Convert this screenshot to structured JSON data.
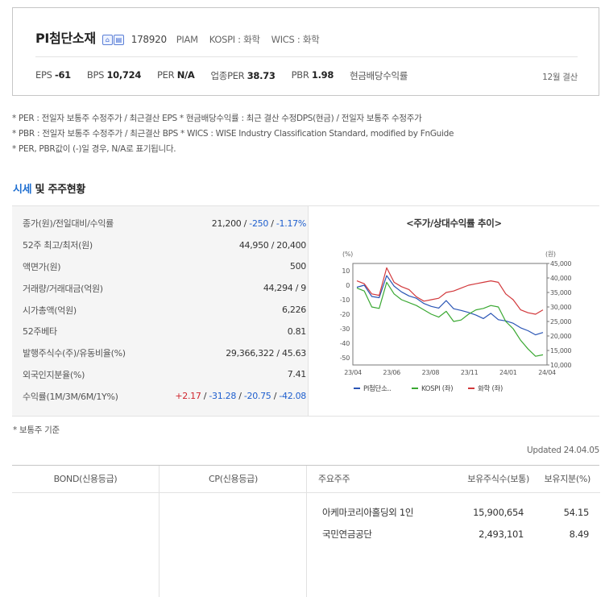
{
  "company": {
    "name": "PI첨단소재",
    "badge_icons": [
      "home-icon",
      "document-icon"
    ],
    "code": "178920",
    "english_code": "PIAM",
    "kospi": "KOSPI : 화학",
    "wics": "WICS : 화학"
  },
  "metrics": [
    {
      "label": "EPS",
      "value": "-61"
    },
    {
      "label": "BPS",
      "value": "10,724"
    },
    {
      "label": "PER",
      "value": "N/A"
    },
    {
      "label": "업종PER",
      "value": "38.73"
    },
    {
      "label": "PBR",
      "value": "1.98"
    },
    {
      "label": "현금배당수익률",
      "value": ""
    }
  ],
  "settlement": "12월 결산",
  "notes": [
    "* PER : 전일자 보통주 수정주가 / 최근결산 EPS * 현금배당수익률 : 최근 결산 수정DPS(현금) / 전일자 보통주 수정주가",
    "* PBR : 전일자 보통주 수정주가 / 최근결산 BPS * WICS : WISE Industry Classification Standard, modified by FnGuide",
    "* PER, PBR값이 (-)일 경우, N/A로 표기됩니다."
  ],
  "section": {
    "highlight": "시세",
    "rest": " 및 주주현황"
  },
  "market_stats": [
    {
      "label": "종가(원)/전일대비/수익률",
      "parts": [
        {
          "text": "21,200",
          "tone": "plain"
        },
        {
          "text": " / ",
          "tone": "plain"
        },
        {
          "text": "-250",
          "tone": "neg"
        },
        {
          "text": " / ",
          "tone": "plain"
        },
        {
          "text": "-1.17%",
          "tone": "neg"
        }
      ]
    },
    {
      "label": "52주 최고/최저(원)",
      "parts": [
        {
          "text": "44,950 / 20,400",
          "tone": "plain"
        }
      ]
    },
    {
      "label": "액면가(원)",
      "parts": [
        {
          "text": "500",
          "tone": "plain"
        }
      ]
    },
    {
      "label": "거래량/거래대금(억원)",
      "parts": [
        {
          "text": "44,294 / 9",
          "tone": "plain"
        }
      ]
    },
    {
      "label": "시가총액(억원)",
      "parts": [
        {
          "text": "6,226",
          "tone": "plain"
        }
      ]
    },
    {
      "label": "52주베타",
      "parts": [
        {
          "text": "0.81",
          "tone": "plain"
        }
      ]
    },
    {
      "label": "발행주식수(주)/유동비율(%)",
      "parts": [
        {
          "text": "29,366,322 / 45.63",
          "tone": "plain"
        }
      ]
    },
    {
      "label": "외국인지분율(%)",
      "parts": [
        {
          "text": "7.41",
          "tone": "plain"
        }
      ]
    },
    {
      "label": "수익률(1M/3M/6M/1Y%)",
      "parts": [
        {
          "text": "+2.17",
          "tone": "pos"
        },
        {
          "text": " / ",
          "tone": "plain"
        },
        {
          "text": "-31.28",
          "tone": "neg"
        },
        {
          "text": " / ",
          "tone": "plain"
        },
        {
          "text": "-20.75",
          "tone": "neg"
        },
        {
          "text": " / ",
          "tone": "plain"
        },
        {
          "text": "-42.08",
          "tone": "neg"
        }
      ]
    }
  ],
  "chart_title": "<주가/상대수익률 추이>",
  "chart_data": {
    "type": "line",
    "title": "<주가/상대수익률 추이>",
    "x_ticks": [
      "23/04",
      "23/06",
      "23/08",
      "23/11",
      "24/01",
      "24/04"
    ],
    "left_axis": {
      "unit": "(%)",
      "range": [
        -55,
        15
      ],
      "ticks": [
        10,
        0,
        -10,
        -20,
        -30,
        -40,
        -50
      ]
    },
    "right_axis": {
      "unit": "(원)",
      "range": [
        10000,
        45000
      ],
      "ticks": [
        "45,000",
        "40,000",
        "35,000",
        "30,000",
        "25,000",
        "20,000",
        "15,000",
        "10,000"
      ]
    },
    "series": [
      {
        "name": "PI첨단소..",
        "color": "#2a55b5",
        "axis": "right",
        "values": [
          36800,
          37500,
          33600,
          33200,
          40800,
          37200,
          35200,
          33800,
          33000,
          31200,
          30200,
          29600,
          32200,
          29400,
          28800,
          28100,
          27200,
          26000,
          27800,
          25600,
          25200,
          24400,
          22800,
          21800,
          20400,
          21200
        ]
      },
      {
        "name": "KOSPI (좌)",
        "color": "#3aa832",
        "axis": "left",
        "values": [
          -2,
          -4,
          -15,
          -16,
          2,
          -6,
          -10,
          -12,
          -14,
          -17,
          -20,
          -22,
          -18,
          -25,
          -24,
          -20,
          -17,
          -16,
          -14,
          -15,
          -25,
          -30,
          -38,
          -44,
          -49,
          -48
        ]
      },
      {
        "name": "화학 (좌)",
        "color": "#d2383b",
        "axis": "left",
        "values": [
          3,
          1,
          -6,
          -7,
          12,
          2,
          -1,
          -3,
          -8,
          -11,
          -10,
          -9,
          -5,
          -4,
          -2,
          0,
          1,
          2,
          3,
          2,
          -6,
          -10,
          -17,
          -19,
          -20,
          -17
        ]
      }
    ]
  },
  "basis_note": "* 보통주 기준",
  "updated": "Updated 24.04.05",
  "bottom_table": {
    "bond_header": "BOND(신용등급)",
    "cp_header": "CP(신용등급)",
    "holder_header": "주요주주",
    "shares_header": "보유주식수(보통)",
    "ratio_header": "보유지분(%)",
    "holders": [
      {
        "name": "아케마코리아홀딩외 1인",
        "shares": "15,900,654",
        "ratio": "54.15"
      },
      {
        "name": "국민연금공단",
        "shares": "2,493,101",
        "ratio": "8.49"
      }
    ]
  }
}
